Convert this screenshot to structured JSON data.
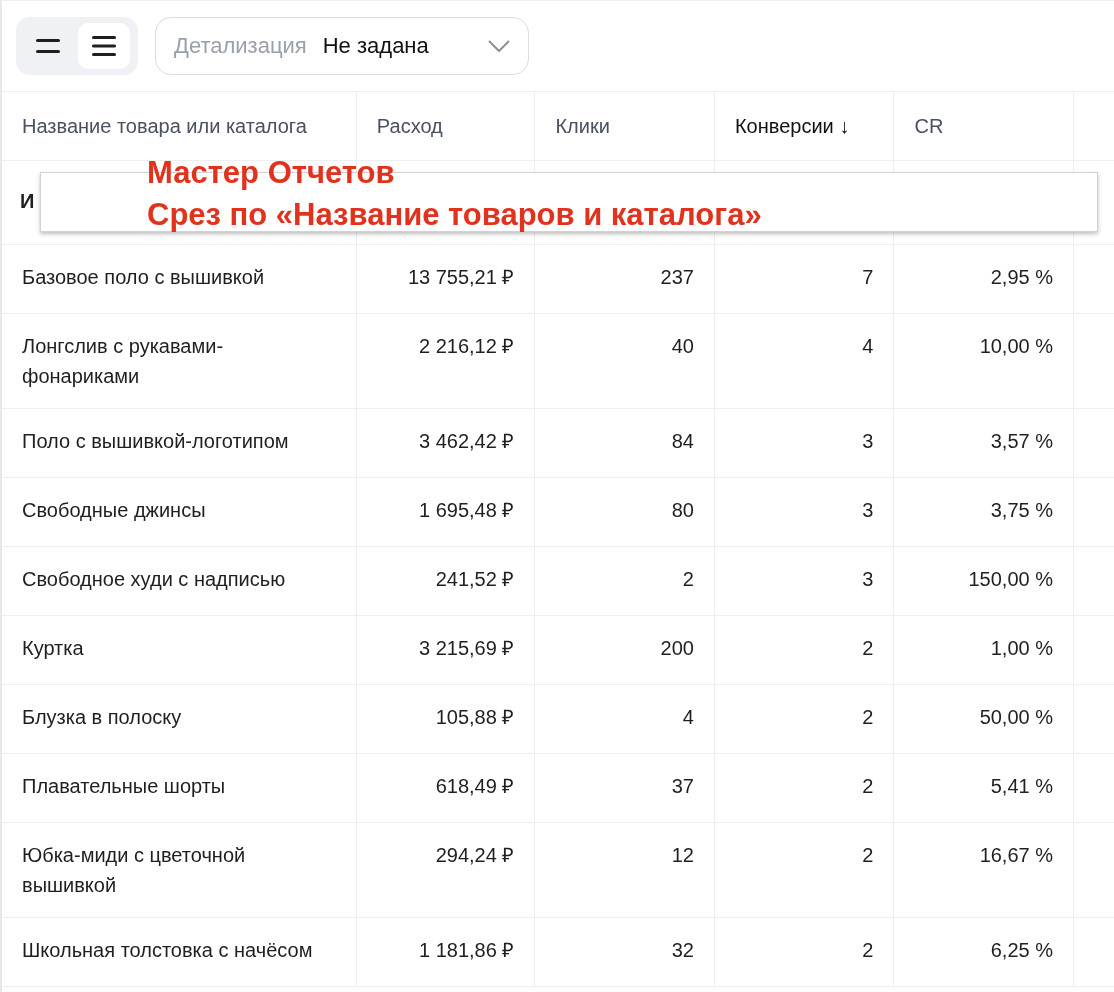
{
  "toolbar": {
    "view_modes": [
      {
        "kind": "compact",
        "selected": false
      },
      {
        "kind": "normal",
        "selected": true
      }
    ],
    "detail_dropdown": {
      "label": "Детализация",
      "value": "Не задана"
    }
  },
  "table": {
    "columns": [
      {
        "label": "Название товара или каталога",
        "sorted": false
      },
      {
        "label": "Расход",
        "sorted": false
      },
      {
        "label": "Клики",
        "sorted": false
      },
      {
        "label": "Конверсии",
        "sorted": true,
        "sort_mark": "↓"
      },
      {
        "label": "CR",
        "sorted": false
      }
    ],
    "totals_row": {
      "label": "И"
    },
    "rows": [
      {
        "name": "Базовое поло с вышивкой",
        "cost": "13 755,21 ₽",
        "clicks": "237",
        "conversions": "7",
        "cr": "2,95 %"
      },
      {
        "name": "Лонгслив с рукавами-фонариками",
        "cost": "2 216,12 ₽",
        "clicks": "40",
        "conversions": "4",
        "cr": "10,00 %"
      },
      {
        "name": "Поло с вышивкой-логотипом",
        "cost": "3 462,42 ₽",
        "clicks": "84",
        "conversions": "3",
        "cr": "3,57 %"
      },
      {
        "name": "Свободные джинсы",
        "cost": "1 695,48 ₽",
        "clicks": "80",
        "conversions": "3",
        "cr": "3,75 %"
      },
      {
        "name": "Свободное худи с надписью",
        "cost": "241,52 ₽",
        "clicks": "2",
        "conversions": "3",
        "cr": "150,00 %"
      },
      {
        "name": "Куртка",
        "cost": "3 215,69 ₽",
        "clicks": "200",
        "conversions": "2",
        "cr": "1,00 %"
      },
      {
        "name": "Блузка в полоску",
        "cost": "105,88 ₽",
        "clicks": "4",
        "conversions": "2",
        "cr": "50,00 %"
      },
      {
        "name": "Плавательные шорты",
        "cost": "618,49 ₽",
        "clicks": "37",
        "conversions": "2",
        "cr": "5,41 %"
      },
      {
        "name": "Юбка-миди с цветочной вышивкой",
        "cost": "294,24 ₽",
        "clicks": "12",
        "conversions": "2",
        "cr": "16,67 %"
      },
      {
        "name": "Школьная толстовка с начёсом",
        "cost": "1 181,86 ₽",
        "clicks": "32",
        "conversions": "2",
        "cr": "6,25 %"
      }
    ]
  },
  "annotation": {
    "lines": [
      "Мастер Отчетов",
      "Срез по «Название товаров и каталога»"
    ]
  }
}
